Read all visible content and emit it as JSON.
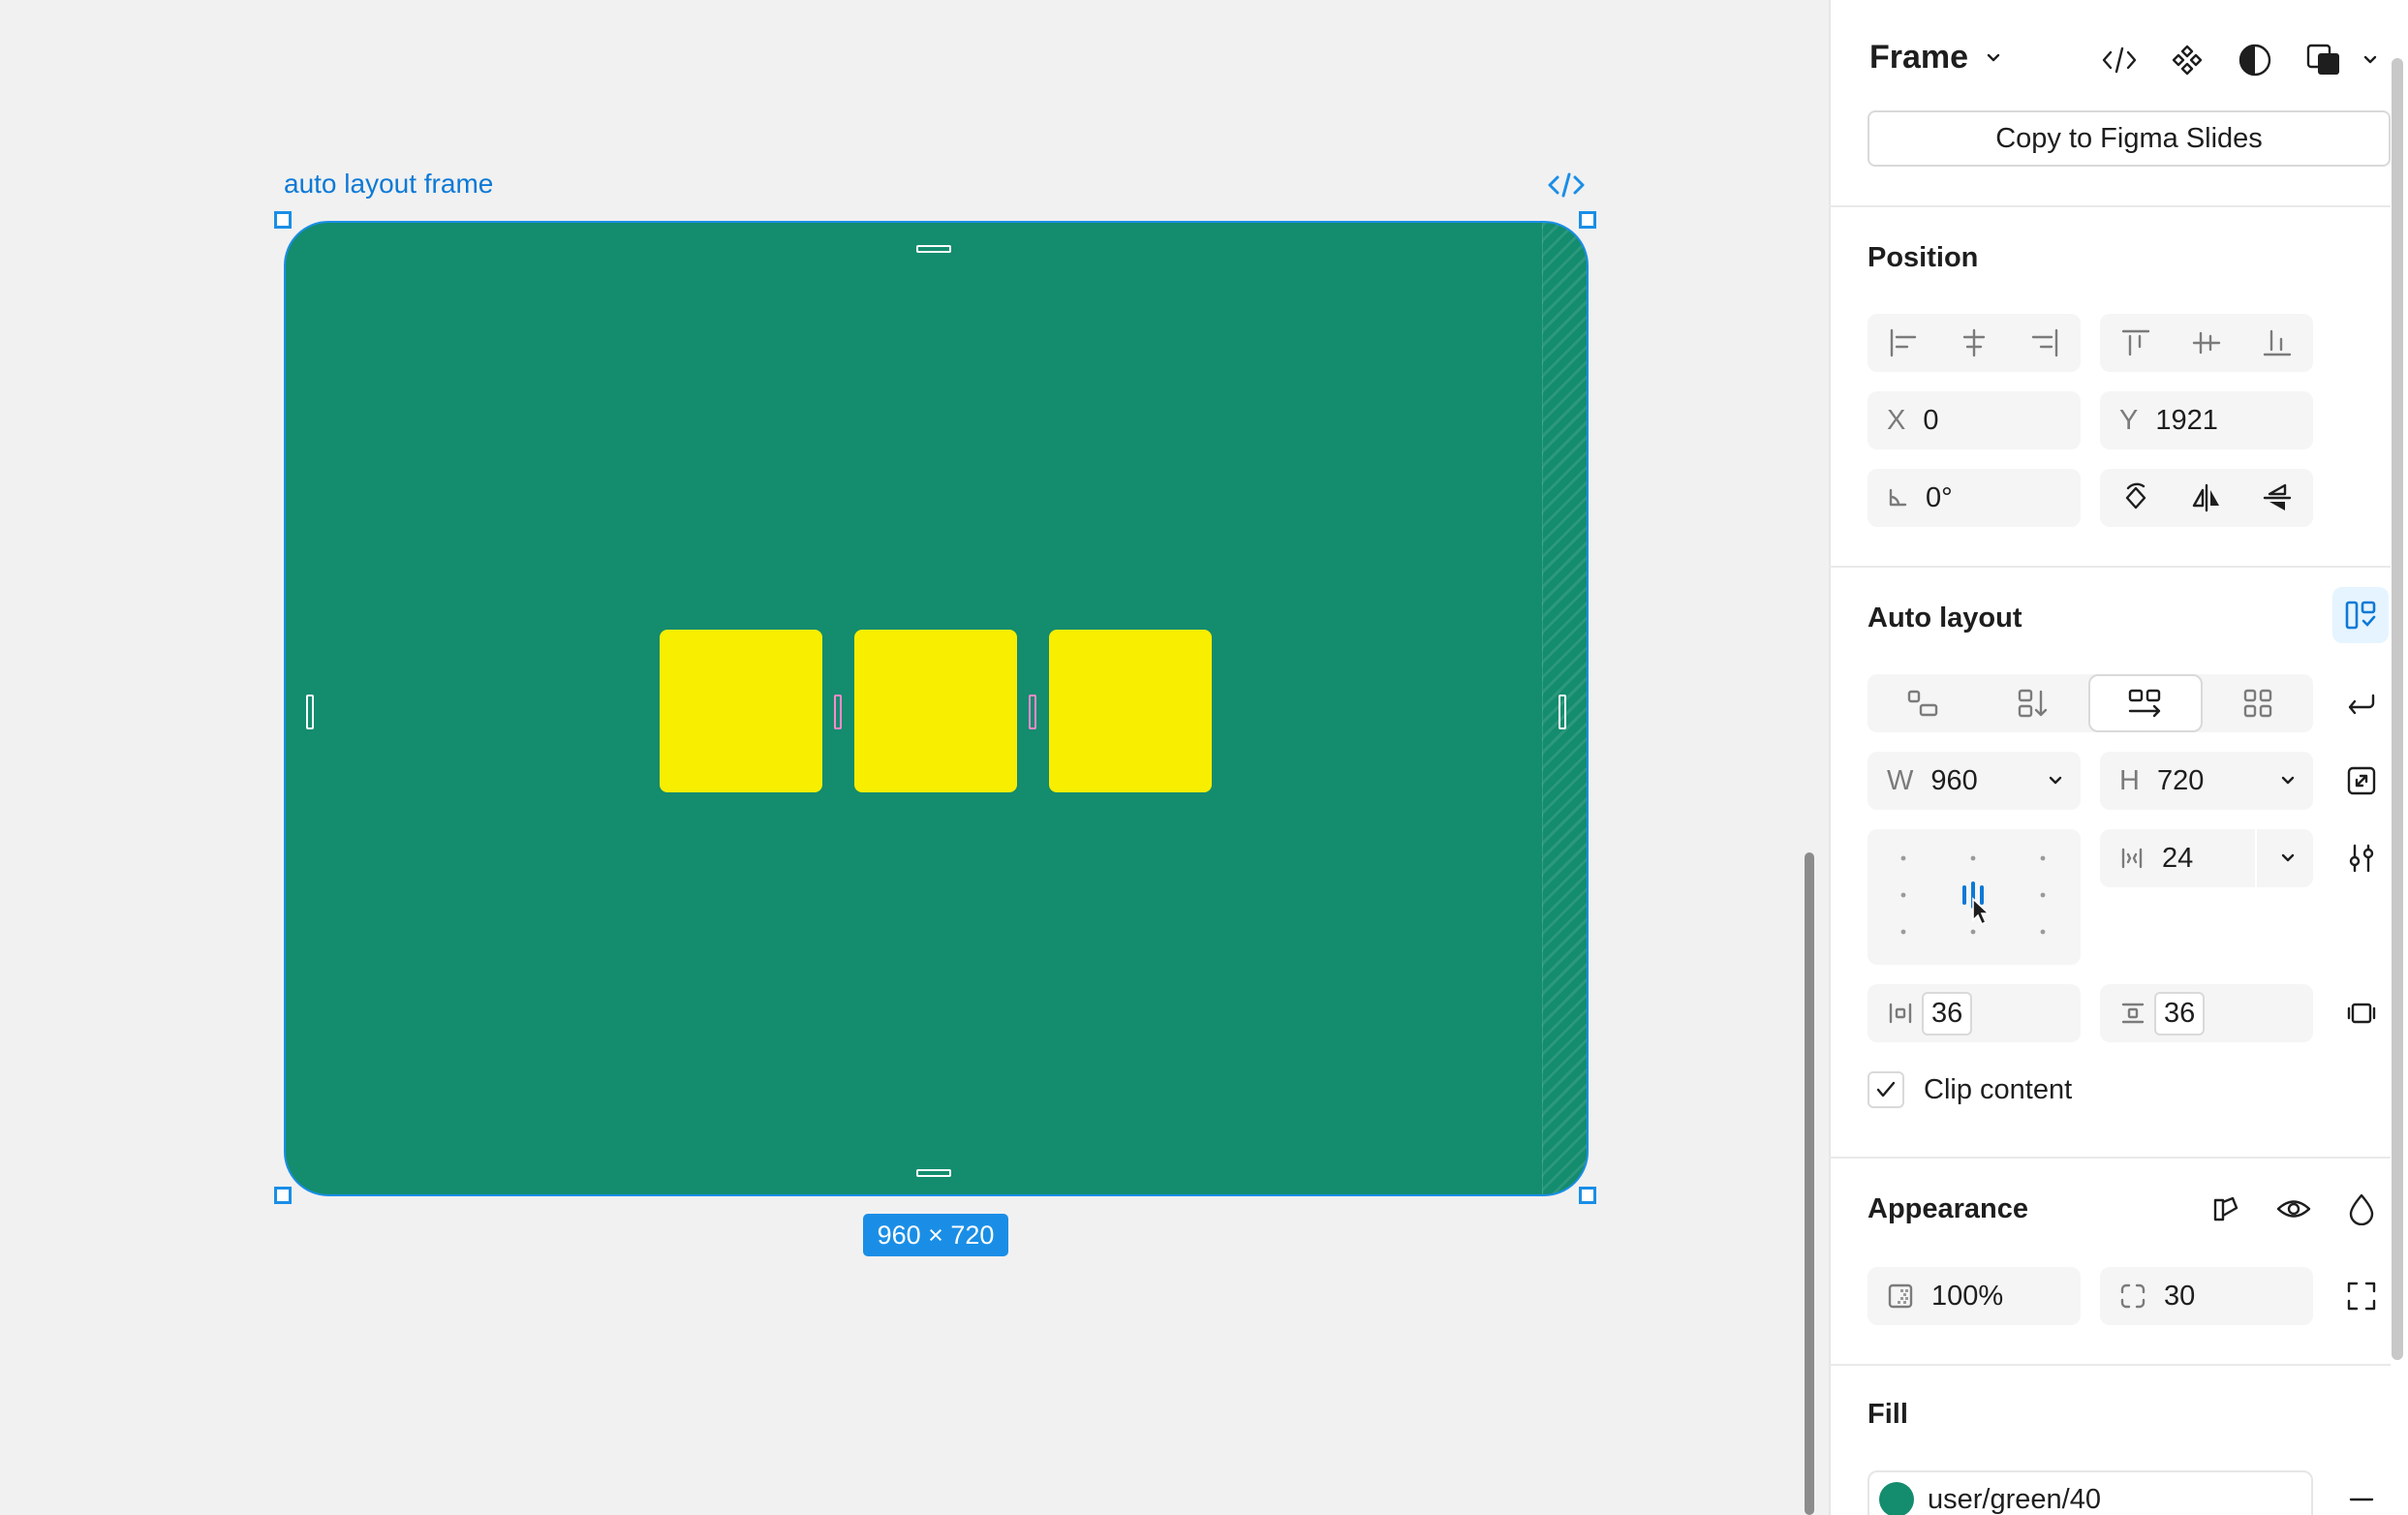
{
  "canvas": {
    "frame_label": "auto layout frame",
    "size_badge": "960 × 720",
    "frame_color": "#148c6e",
    "child_color": "#f8ee00",
    "selection_color": "#1a8ee6"
  },
  "panel": {
    "header": {
      "title": "Frame",
      "icons": [
        "code-icon",
        "component-icon",
        "contrast-icon",
        "boolean-icon"
      ]
    },
    "copy_button": "Copy to Figma Slides",
    "position": {
      "title": "Position",
      "x_label": "X",
      "x_value": "0",
      "y_label": "Y",
      "y_value": "1921",
      "rotation_value": "0°"
    },
    "auto_layout": {
      "title": "Auto layout",
      "w_label": "W",
      "w_value": "960",
      "h_label": "H",
      "h_value": "720",
      "gap_value": "24",
      "padding_h": "36",
      "padding_v": "36",
      "clip_label": "Clip content",
      "clip_checked": true
    },
    "appearance": {
      "title": "Appearance",
      "opacity": "100%",
      "radius": "30"
    },
    "fill": {
      "title": "Fill",
      "swatch_color": "#148c6e",
      "style_name": "user/green/40"
    }
  }
}
